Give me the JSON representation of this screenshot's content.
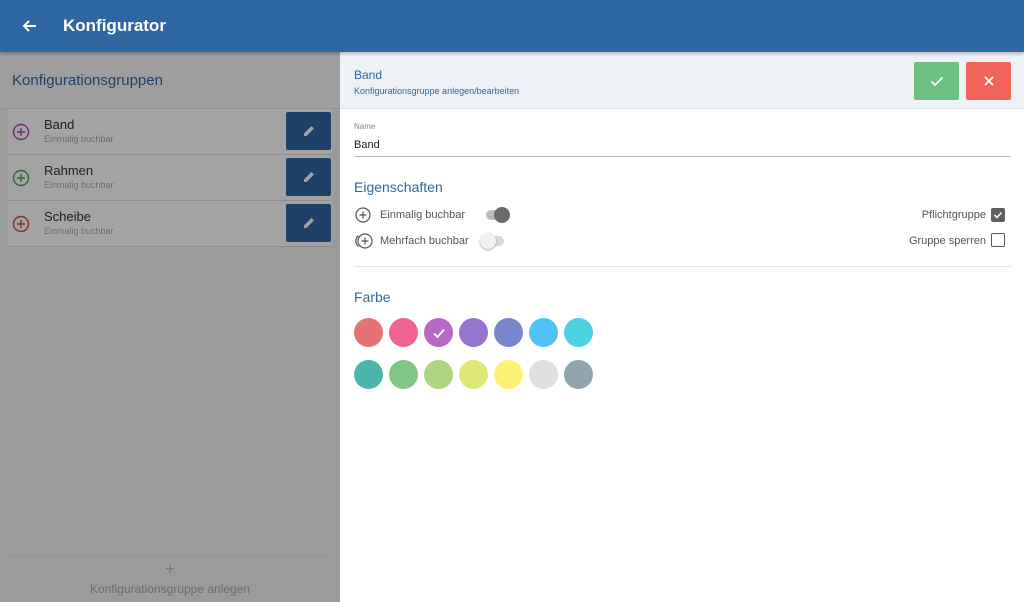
{
  "header": {
    "title": "Konfigurator",
    "back_icon": "arrow-left-icon"
  },
  "left_panel": {
    "title": "Konfigurationsgruppen",
    "groups": [
      {
        "name": "Band",
        "subtitle": "Einmalig buchbar",
        "icon_color": "#b14bb6"
      },
      {
        "name": "Rahmen",
        "subtitle": "Einmalig buchbar",
        "icon_color": "#3aa85a"
      },
      {
        "name": "Scheibe",
        "subtitle": "Einmalig buchbar",
        "icon_color": "#d04a3d"
      }
    ],
    "add_plus": "+",
    "add_label": "Konfigurationsgruppe anlegen"
  },
  "editor": {
    "title": "Band",
    "subtitle": "Konfigurationsgruppe anlegen/bearbeiten",
    "name_label": "Name",
    "name_value": "Band",
    "properties_title": "Eigenschaften",
    "option_single": {
      "label": "Einmalig buchbar",
      "enabled": true
    },
    "option_multiple": {
      "label": "Mehrfach buchbar",
      "enabled": false
    },
    "mandatory": {
      "label": "Pflichtgruppe",
      "checked": true
    },
    "lock": {
      "label": "Gruppe sperren",
      "checked": false
    },
    "color_title": "Farbe",
    "colors": [
      "#e57373",
      "#f06292",
      "#ba68c8",
      "#9575cd",
      "#7986cb",
      "#4fc3f7",
      "#4dd0e1",
      "#4db6ac",
      "#81c784",
      "#aed581",
      "#dce775",
      "#fff176",
      "#e0e0e0",
      "#90a4ae"
    ],
    "selected_color_index": 2
  },
  "colors": {
    "primary": "#2f67a3",
    "confirm": "#6cc080",
    "cancel": "#f2665a"
  }
}
